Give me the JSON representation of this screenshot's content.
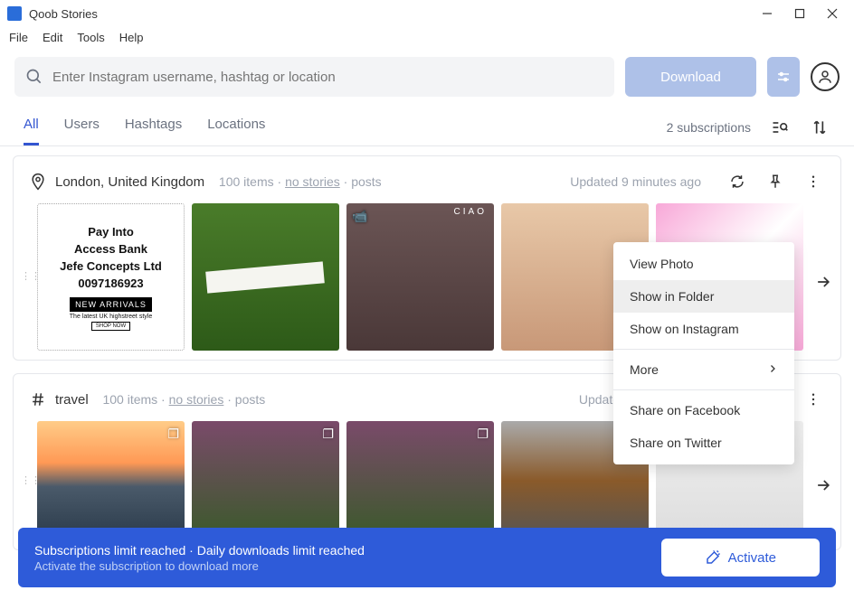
{
  "window": {
    "title": "Qoob Stories"
  },
  "menubar": [
    "File",
    "Edit",
    "Tools",
    "Help"
  ],
  "search": {
    "placeholder": "Enter Instagram username, hashtag or location",
    "download_label": "Download"
  },
  "tabs": {
    "items": [
      "All",
      "Users",
      "Hashtags",
      "Locations"
    ],
    "active": 0,
    "subscriptions_text": "2 subscriptions"
  },
  "sections": [
    {
      "icon": "location",
      "title": "London, United Kingdom",
      "items_count": "100 items",
      "no_stories": "no stories",
      "posts": "posts",
      "updated": "Updated 9 minutes ago"
    },
    {
      "icon": "hashtag",
      "title": "travel",
      "items_count": "100 items",
      "no_stories": "no stories",
      "posts": "posts",
      "updated": "Update"
    }
  ],
  "thumb1": {
    "l1": "Pay Into",
    "l2": "Access Bank",
    "l3": "Jefe Concepts Ltd",
    "l4": "0097186923",
    "bar": "NEW ARRIVALS",
    "sub": "The latest UK highstreet style",
    "btn": "SHOP NOW"
  },
  "context_menu": {
    "items": [
      {
        "label": "View Photo"
      },
      {
        "label": "Show in Folder",
        "highlighted": true
      },
      {
        "label": "Show on Instagram"
      },
      {
        "label": "More",
        "submenu": true
      },
      {
        "label": "Share on Facebook"
      },
      {
        "label": "Share on Twitter"
      }
    ]
  },
  "banner": {
    "line1": "Subscriptions limit reached · Daily downloads limit reached",
    "line2": "Activate the subscription to download more",
    "activate_label": "Activate"
  }
}
